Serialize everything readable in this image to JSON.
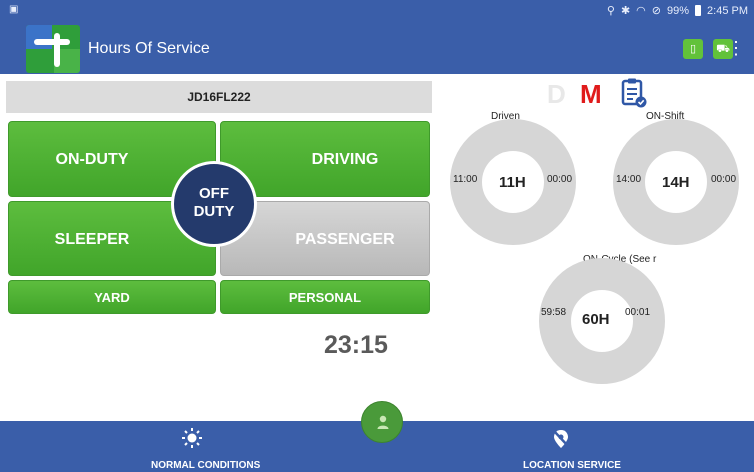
{
  "status_bar": {
    "notification_icon": "photo-notification-icon",
    "battery": "99%",
    "time": "2:45 PM"
  },
  "app_bar": {
    "title": "Hours Of Service",
    "icons": [
      "phone-status-icon",
      "truck-icon",
      "overflow-menu-icon"
    ]
  },
  "vehicle": {
    "id": "JD16FL222"
  },
  "duty_status": {
    "on_duty": "ON-DUTY",
    "driving": "DRIVING",
    "sleeper": "SLEEPER",
    "passenger": "PASSENGER",
    "yard": "YARD",
    "personal": "PERSONAL",
    "off_duty_line1": "OFF",
    "off_duty_line2": "DUTY",
    "timer": "23:15"
  },
  "indicators": {
    "d": "D",
    "m": "M",
    "d_color": "#e8e8e8",
    "m_color": "#e01b1b"
  },
  "gauges": {
    "driven": {
      "label": "Driven",
      "center": "11H",
      "left": "11:00",
      "right": "00:00"
    },
    "on_shift": {
      "label": "ON-Shift",
      "center": "14H",
      "left": "14:00",
      "right": "00:00"
    },
    "on_cycle": {
      "label": "ON-Cycle (See r",
      "center": "60H",
      "left": "59:58",
      "right": "00:01"
    }
  },
  "bottom_bar": {
    "conditions": "NORMAL CONDITIONS",
    "location": "LOCATION SERVICE"
  },
  "colors": {
    "primary": "#3a5ea9",
    "green": "#4aae33",
    "navy": "#243a6c"
  }
}
